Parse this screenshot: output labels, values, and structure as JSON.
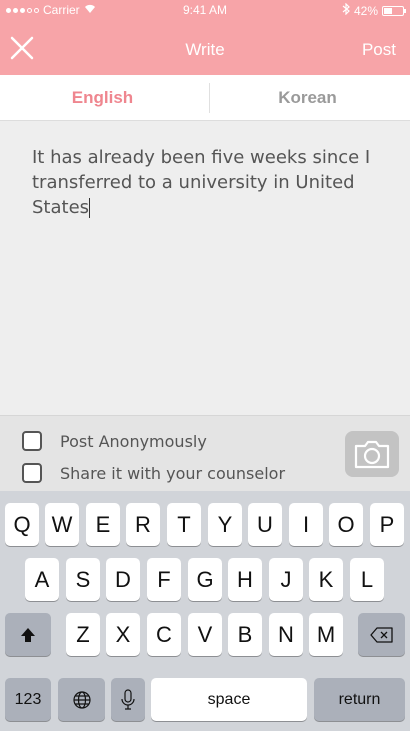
{
  "status_bar": {
    "carrier": "Carrier",
    "time": "9:41 AM",
    "battery": "42%",
    "battery_level": 0.42
  },
  "nav": {
    "title": "Write",
    "post_label": "Post",
    "close_icon": "close-icon"
  },
  "tabs": [
    {
      "label": "English",
      "active": true
    },
    {
      "label": "Korean",
      "active": false
    }
  ],
  "editor": {
    "text": "It has already been five weeks since I transferred to a university in United States"
  },
  "options": [
    {
      "label": "Post Anonymously",
      "checked": false
    },
    {
      "label": "Share it with your counselor",
      "checked": false
    }
  ],
  "camera_icon": "camera-icon",
  "keyboard": {
    "row1": [
      "Q",
      "W",
      "E",
      "R",
      "T",
      "Y",
      "U",
      "I",
      "O",
      "P"
    ],
    "row2": [
      "A",
      "S",
      "D",
      "F",
      "G",
      "H",
      "J",
      "K",
      "L"
    ],
    "row3": [
      "Z",
      "X",
      "C",
      "V",
      "B",
      "N",
      "M"
    ],
    "numbers_label": "123",
    "space_label": "space",
    "return_label": "return",
    "shift_icon": "shift-icon",
    "delete_icon": "delete-icon",
    "globe_icon": "globe-icon",
    "mic_icon": "microphone-icon"
  },
  "colors": {
    "accent": "#f7a4a8",
    "active_tab": "#ef868f",
    "inactive_tab": "#9a9a9a"
  }
}
